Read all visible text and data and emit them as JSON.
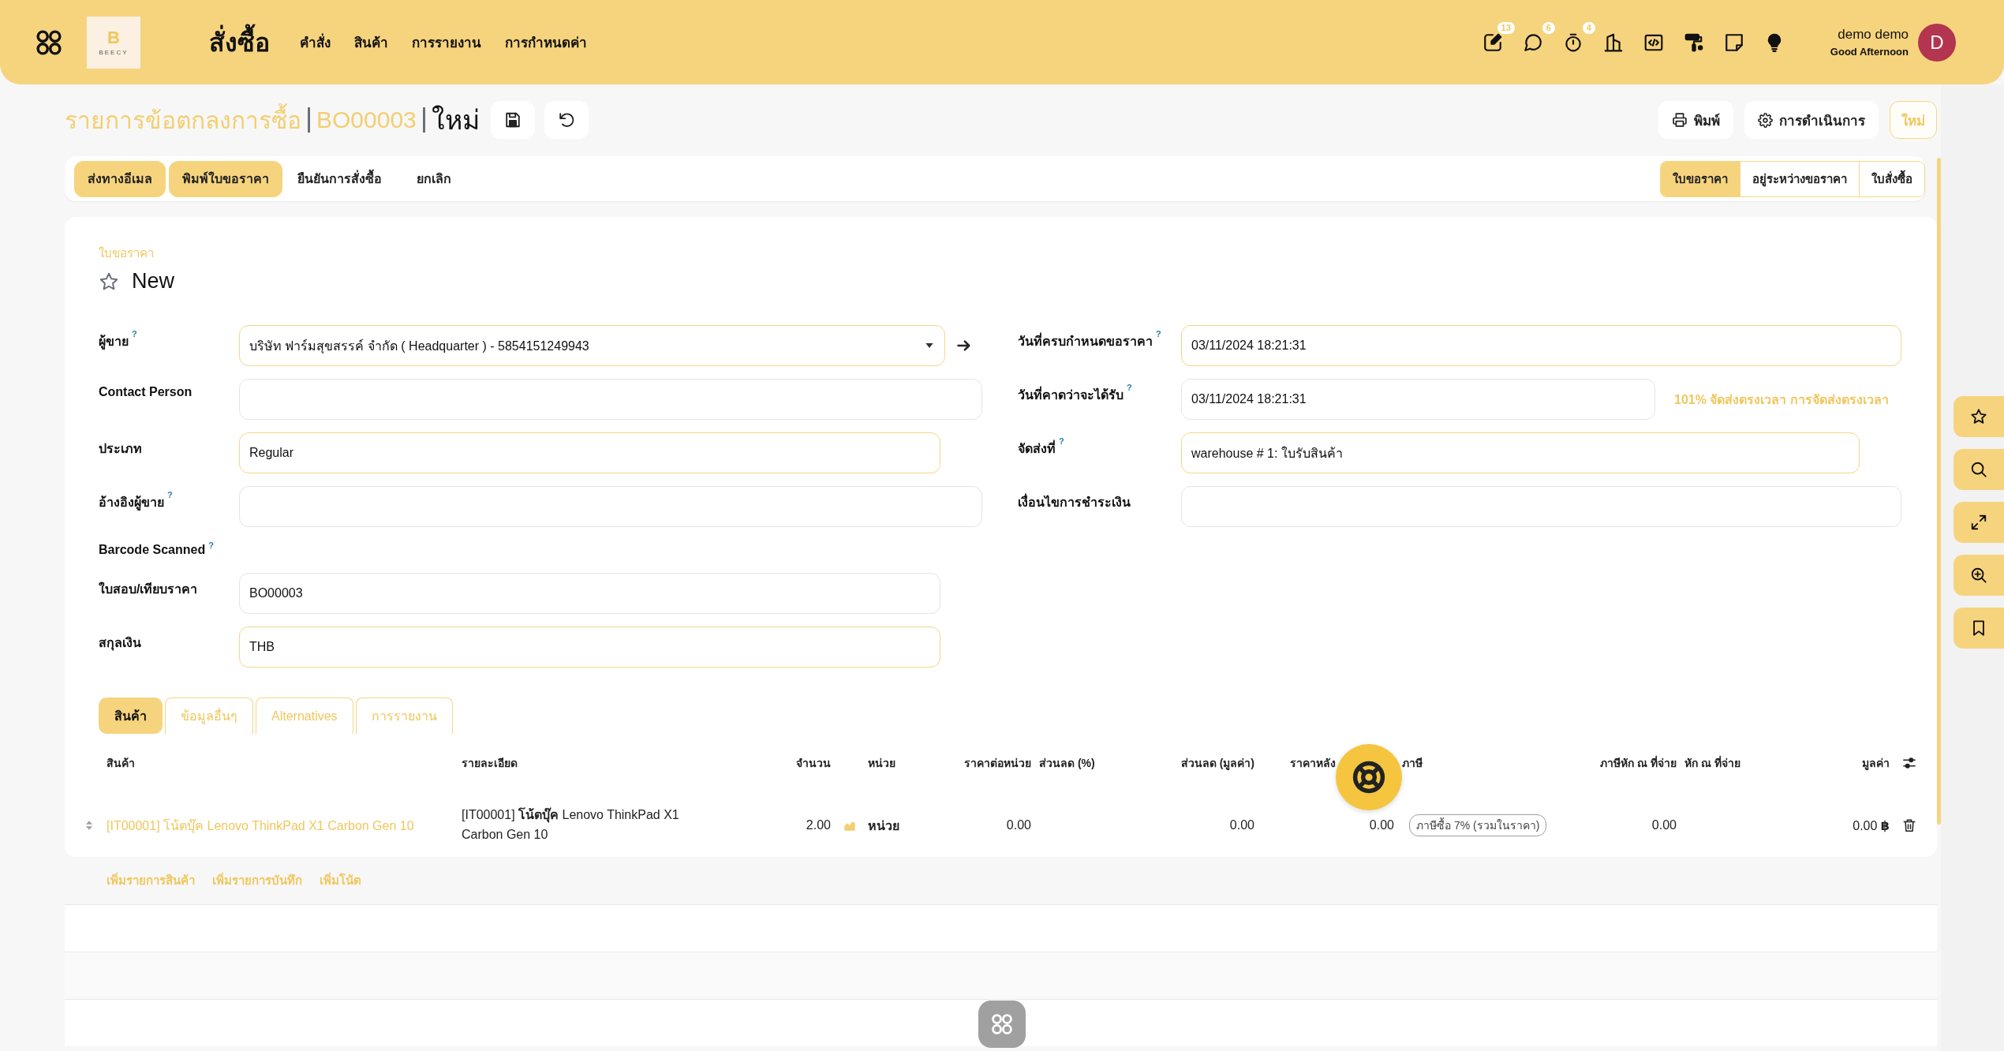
{
  "top_bar": {
    "logo": {
      "mark": "B",
      "name": "BEECY"
    },
    "app_title": "สั่งซื้อ",
    "menu": [
      "คำสั่ง",
      "สินค้า",
      "การรายงาน",
      "การกำหนดค่า"
    ],
    "tools": [
      {
        "kind": "edit",
        "badge": "13"
      },
      {
        "kind": "chat",
        "badge": "6"
      },
      {
        "kind": "timer",
        "badge": "4"
      },
      {
        "kind": "building"
      },
      {
        "kind": "code"
      },
      {
        "kind": "roller"
      },
      {
        "kind": "note"
      },
      {
        "kind": "bulb"
      }
    ],
    "user": {
      "name": "demo demo",
      "greeting": "Good Afternoon",
      "initial": "D"
    }
  },
  "breadcrumb": {
    "parent": "รายการข้อตกลงการซื้อ",
    "record": "BO00003",
    "current": "ใหม่"
  },
  "record_buttons": [
    {
      "kind": "save"
    },
    {
      "kind": "undo"
    }
  ],
  "header_buttons": [
    {
      "kind": "print",
      "label": "พิมพ์"
    },
    {
      "kind": "actions",
      "label": "การดำเนินการ"
    },
    {
      "kind": "new",
      "label": "ใหม่"
    }
  ],
  "action_buttons": [
    {
      "label": "ส่งทางอีเมล",
      "primary": true
    },
    {
      "label": "พิมพ์ใบขอราคา",
      "primary": true
    },
    {
      "label": "ยืนยันการสั่งซื้อ",
      "primary": false
    },
    {
      "label": "ยกเลิก",
      "primary": false
    }
  ],
  "status_steps": [
    {
      "label": "ใบขอราคา",
      "selected": true
    },
    {
      "label": "อยู่ระหว่างขอราคา",
      "selected": false
    },
    {
      "label": "ใบสั่งซื้อ",
      "selected": false
    }
  ],
  "record": {
    "type": "ใบขอราคา",
    "title": "New",
    "starred": false
  },
  "form_left": [
    {
      "label": "ผู้ขาย",
      "help": "?",
      "kind": "select",
      "value": "บริษัท ฟาร์มสุขสรรค์ จำกัด ( Headquarter ) - 5854151249943",
      "required": true
    },
    {
      "label": "Contact Person",
      "kind": "input",
      "required": false
    },
    {
      "label": "ประเภท",
      "kind": "input",
      "value": "Regular",
      "required": true
    },
    {
      "label": "อ้างอิงผู้ขาย",
      "help": "?",
      "kind": "input",
      "required": false
    },
    {
      "label": "Barcode Scanned",
      "help": "?",
      "kind": "label"
    },
    {
      "label": "ใบสอบ/เทียบราคา",
      "kind": "input",
      "value": "BO00003",
      "required": false
    },
    {
      "label": "สกุลเงิน",
      "kind": "input",
      "value": "THB",
      "required": true
    }
  ],
  "form_right": [
    {
      "label": "วันที่ครบกำหนดขอราคา",
      "help": "?",
      "kind": "input",
      "value": "03/11/2024 18:21:31",
      "required": true
    },
    {
      "label": "วันที่คาดว่าจะได้รับ",
      "help": "?",
      "kind": "input",
      "value": "03/11/2024 18:21:31",
      "required": false,
      "note": "101% จัดส่งตรงเวลา การจัดส่งตรงเวลา"
    },
    {
      "label": "จัดส่งที่",
      "help": "?",
      "kind": "input",
      "value": "warehouse # 1: ใบรับสินค้า",
      "required": true
    },
    {
      "label": "เงื่อนไขการชำระเงิน",
      "kind": "input",
      "required": false
    }
  ],
  "tabs": [
    {
      "label": "สินค้า",
      "selected": true
    },
    {
      "label": "ข้อมูลอื่นๆ",
      "selected": false
    },
    {
      "label": "Alternatives",
      "selected": false
    },
    {
      "label": "การรายงาน",
      "selected": false
    }
  ],
  "lines_table": {
    "columns": [
      "สินค้า",
      "รายละเอียด",
      "จำนวน",
      "หน่วย",
      "ราคาต่อหน่วย",
      "ส่วนลด (%)",
      "ส่วนลด (มูลค่า)",
      "ราคาหลัง",
      "ภาษี",
      "ภาษีหัก ณ ที่จ่าย",
      "หัก ณ ที่จ่าย",
      "มูลค่า"
    ],
    "rows": [
      {
        "product": "[IT00001] โน้ตบุ๊ค Lenovo ThinkPad X1 Carbon Gen 10",
        "description": "[IT00001] **โน้ตบุ๊ค** Lenovo ThinkPad X1 Carbon Gen 10",
        "quantity": "2.00",
        "unit": "หน่วย",
        "unit_price": "0.00",
        "discount_amount": "0.00",
        "price_after": "0.00",
        "tax": "ภาษีซื้อ 7% (รวมในราคา)",
        "withholding": "0.00",
        "amount": "0.00 **฿**"
      }
    ]
  },
  "add_links": [
    "เพิ่มรายการสินค้า",
    "เพิ่มรายการบันทึก",
    "เพิ่มโน้ต"
  ]
}
